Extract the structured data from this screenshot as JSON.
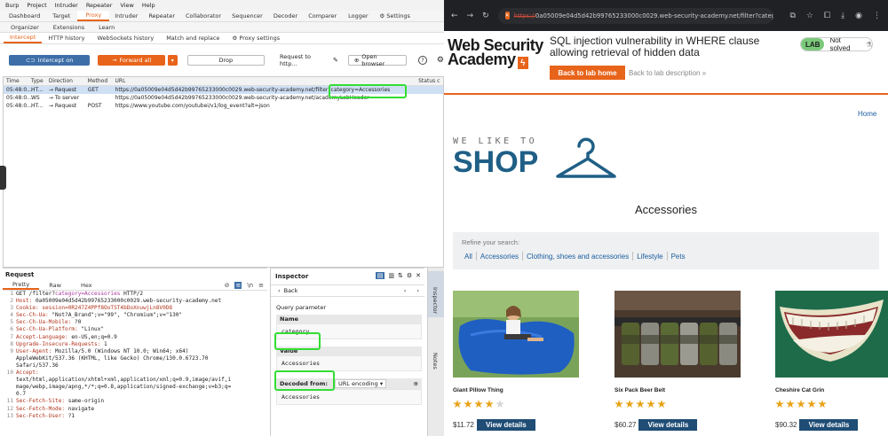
{
  "burp": {
    "menu": [
      "Burp",
      "Project",
      "Intruder",
      "Repeater",
      "View",
      "Help"
    ],
    "tabs": [
      "Dashboard",
      "Target",
      "Proxy",
      "Intruder",
      "Repeater",
      "Collaborator",
      "Sequencer",
      "Decoder",
      "Comparer",
      "Logger",
      "Settings"
    ],
    "active_tab": "Proxy",
    "tabs_row2": [
      "Organizer",
      "Extensions",
      "Learn"
    ],
    "proxy_tabs": [
      "Intercept",
      "HTTP history",
      "WebSockets history",
      "Match and replace",
      "Proxy settings"
    ],
    "toolbar": {
      "intercept": "Intercept on",
      "forward": "Forward all",
      "drop": "Drop",
      "request_to": "Request to http...",
      "open_browser": "Open browser",
      "help": "?"
    },
    "history": {
      "columns": [
        "Time",
        "Type",
        "Direction",
        "Method",
        "URL",
        "Status c"
      ],
      "rows": [
        {
          "time": "05:48:0...",
          "type": "HT...",
          "dir": "Request",
          "method": "GET",
          "url": "https://0a05009e04d5d42b99765233000c0029.web-security-academy.net/filter?category=Accessories"
        },
        {
          "time": "05:48:0...",
          "type": "WS",
          "dir": "To server",
          "method": "",
          "url": "https://0a05009e04d5d42b99765233000c0029.web-security-academy.net/academyLabHeader"
        },
        {
          "time": "05:48:0...",
          "type": "HT...",
          "dir": "Request",
          "method": "POST",
          "url": "https://www.youtube.com/youtubei/v1/log_event?alt=json"
        }
      ]
    },
    "request": {
      "title": "Request",
      "tabs": [
        "Pretty",
        "Raw",
        "Hex"
      ],
      "lines": [
        {
          "n": "1",
          "a": "GET /filter?",
          "b": "category=Accessories",
          "c": " HTTP/2"
        },
        {
          "n": "2",
          "a": "Host:",
          "c": " 0a05009e04d5d42b99765233000c0029.web-security-academy.net"
        },
        {
          "n": "3",
          "a": "Cookie:",
          "c": " session=0R247Z4PPf8OoTST4bDoXnuwjLn8V0D8"
        },
        {
          "n": "4",
          "a": "Sec-Ch-Ua:",
          "c": " \"Not?A_Brand\";v=\"99\", \"Chromium\";v=\"130\""
        },
        {
          "n": "5",
          "a": "Sec-Ch-Ua-Mobile:",
          "c": " ?0"
        },
        {
          "n": "6",
          "a": "Sec-Ch-Ua-Platform:",
          "c": " \"Linux\""
        },
        {
          "n": "7",
          "a": "Accept-Language:",
          "c": " en-US,en;q=0.9"
        },
        {
          "n": "8",
          "a": "Upgrade-Insecure-Requests:",
          "c": " 1"
        },
        {
          "n": "9",
          "a": "User-Agent:",
          "c": " Mozilla/5.0 (Windows NT 10.0; Win64; x64)"
        },
        {
          "n": "",
          "a": "",
          "c": "AppleWebKit/537.36 (KHTML, like Gecko) Chrome/130.0.6723.70"
        },
        {
          "n": "",
          "a": "",
          "c": "Safari/537.36"
        },
        {
          "n": "10",
          "a": "Accept:",
          "c": ""
        },
        {
          "n": "",
          "a": "",
          "c": "text/html,application/xhtml+xml,application/xml;q=0.9,image/avif,i"
        },
        {
          "n": "",
          "a": "",
          "c": "mage/webp,image/apng,*/*;q=0.8,application/signed-exchange;v=b3;q="
        },
        {
          "n": "",
          "a": "",
          "c": "0.7"
        },
        {
          "n": "11",
          "a": "Sec-Fetch-Site:",
          "c": " same-origin"
        },
        {
          "n": "12",
          "a": "Sec-Fetch-Mode:",
          "c": " navigate"
        },
        {
          "n": "13",
          "a": "Sec-Fetch-User:",
          "c": " ?1"
        }
      ]
    },
    "inspector": {
      "title": "Inspector",
      "back": "Back",
      "section": "Query parameter",
      "name_label": "Name",
      "name_value": "category",
      "value_label": "Value",
      "value_value": "Accessories",
      "decoded_from": "Decoded from:",
      "encoding": "URL encoding",
      "decoded_value": "Accessories",
      "side_tabs": [
        "Inspector",
        "Notes"
      ]
    }
  },
  "browser": {
    "url_prefix": "https://",
    "url_rest": "0a05009e04d5d42b99765233000c0029.web-security-academy.net/filter?categ...",
    "logo_line1": "Web Security",
    "logo_line2": "Academy",
    "lab_title": "SQL injection vulnerability in WHERE clause allowing retrieval of hidden data",
    "lab_badge": "LAB",
    "lab_status": "Not solved",
    "back_home": "Back to lab home",
    "back_desc": "Back to lab description »",
    "home": "Home",
    "shop_tagline": "WE LIKE TO",
    "shop_word": "SHOP",
    "category_title": "Accessories",
    "refine_label": "Refine your search:",
    "filters": [
      "All",
      "Accessories",
      "Clothing, shoes and accessories",
      "Lifestyle",
      "Pets"
    ],
    "products": [
      {
        "name": "Giant Pillow Thing",
        "price": "$11.72",
        "rating": 4,
        "button": "View details"
      },
      {
        "name": "Six Pack Beer Belt",
        "price": "$60.27",
        "rating": 5,
        "button": "View details"
      },
      {
        "name": "Cheshire Cat Grin",
        "price": "$90.32",
        "rating": 5,
        "button": "View details"
      }
    ]
  }
}
